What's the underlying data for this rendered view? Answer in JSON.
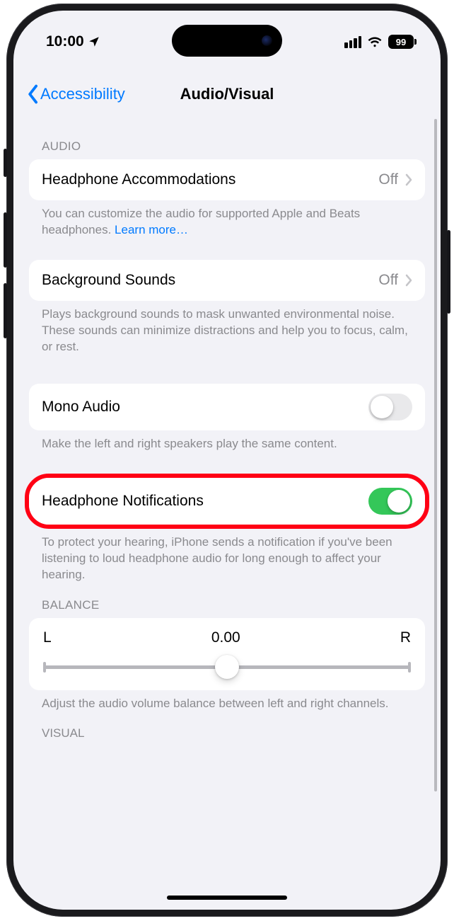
{
  "status": {
    "time": "10:00",
    "battery": "99"
  },
  "nav": {
    "back": "Accessibility",
    "title": "Audio/Visual"
  },
  "sections": {
    "audio_header": "AUDIO",
    "balance_header": "BALANCE",
    "visual_header": "VISUAL"
  },
  "rows": {
    "headphone_accom": {
      "label": "Headphone Accommodations",
      "value": "Off"
    },
    "headphone_accom_footer_a": "You can customize the audio for supported Apple and Beats headphones. ",
    "headphone_accom_footer_link": "Learn more…",
    "bg_sounds": {
      "label": "Background Sounds",
      "value": "Off"
    },
    "bg_sounds_footer": "Plays background sounds to mask unwanted environmental noise. These sounds can minimize distractions and help you to focus, calm, or rest.",
    "mono_audio": {
      "label": "Mono Audio"
    },
    "mono_audio_footer": "Make the left and right speakers play the same content.",
    "headphone_notif": {
      "label": "Headphone Notifications"
    },
    "headphone_notif_footer": "To protect your hearing, iPhone sends a notification if you've been listening to loud headphone audio for long enough to affect your hearing."
  },
  "balance": {
    "left": "L",
    "value": "0.00",
    "right": "R",
    "footer": "Adjust the audio volume balance between left and right channels."
  }
}
